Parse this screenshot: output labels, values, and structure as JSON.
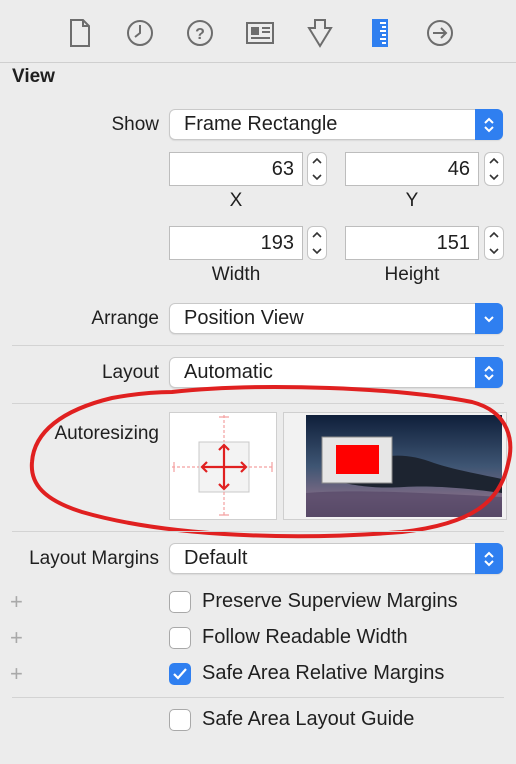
{
  "toolbar": {
    "icons": [
      "file-inspector-icon",
      "history-inspector-icon",
      "quick-help-icon",
      "identity-inspector-icon",
      "attributes-inspector-icon",
      "size-inspector-icon",
      "connections-inspector-icon"
    ],
    "active_icon": "size-inspector-icon",
    "accent": "#2f7ff0"
  },
  "view": {
    "section_title": "View",
    "show_label": "Show",
    "show_value": "Frame Rectangle",
    "x_value": "63",
    "y_value": "46",
    "x_label": "X",
    "y_label": "Y",
    "width_value": "193",
    "height_value": "151",
    "width_label": "Width",
    "height_label": "Height",
    "arrange_label": "Arrange",
    "arrange_value": "Position View",
    "layout_label": "Layout",
    "layout_value": "Automatic",
    "autoresizing_label": "Autoresizing",
    "layout_margins_label": "Layout Margins",
    "layout_margins_value": "Default"
  },
  "checkboxes": [
    {
      "label": "Preserve Superview Margins",
      "checked": false
    },
    {
      "label": "Follow Readable Width",
      "checked": false
    },
    {
      "label": "Safe Area Relative Margins",
      "checked": true
    },
    {
      "label": "Safe Area Layout Guide",
      "checked": false
    }
  ],
  "annotation_color": "#e02020"
}
